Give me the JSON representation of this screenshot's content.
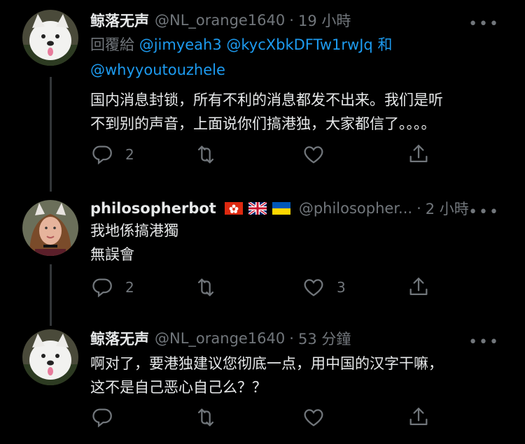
{
  "tweets": [
    {
      "name": "鲸落无声",
      "handle": "@NL_orange1640",
      "time": "19 小時",
      "replying_prefix": "回覆給",
      "replying_to": "@jimyeah3 @kycXbkDFTw1rwJq",
      "replying_and": "和",
      "replying_to2": "@whyyoutouzhele",
      "text_lines": [
        "国内消息封锁，所有不利的消息都发不出来。我们是听",
        "不到别的声音，上面说你们搞港独，大家都信了。。。。"
      ],
      "reply_count": "2",
      "retweet_count": "",
      "like_count": "",
      "avatar": "dog-avatar"
    },
    {
      "name": "philosopherbot",
      "flags": [
        "hong-kong-flag",
        "uk-flag",
        "ukraine-flag"
      ],
      "handle": "@philosopher...",
      "time": "2 小時",
      "text_lines": [
        "我地係搞港獨",
        "無誤會"
      ],
      "reply_count": "2",
      "retweet_count": "",
      "like_count": "3",
      "avatar": "woman-cat-ears-avatar"
    },
    {
      "name": "鲸落无声",
      "handle": "@NL_orange1640",
      "time": "53 分鐘",
      "text_lines": [
        "啊对了，要港独建议您彻底一点，用中国的汉字干嘛，",
        "这不是自己恶心自己么？？"
      ],
      "reply_count": "",
      "retweet_count": "",
      "like_count": "",
      "avatar": "dog-avatar"
    }
  ],
  "sep": "·",
  "more_glyph": "•••",
  "colors": {
    "background": "#000000",
    "text": "#e7e9ea",
    "muted": "#71767b",
    "link": "#1d9bf0"
  }
}
